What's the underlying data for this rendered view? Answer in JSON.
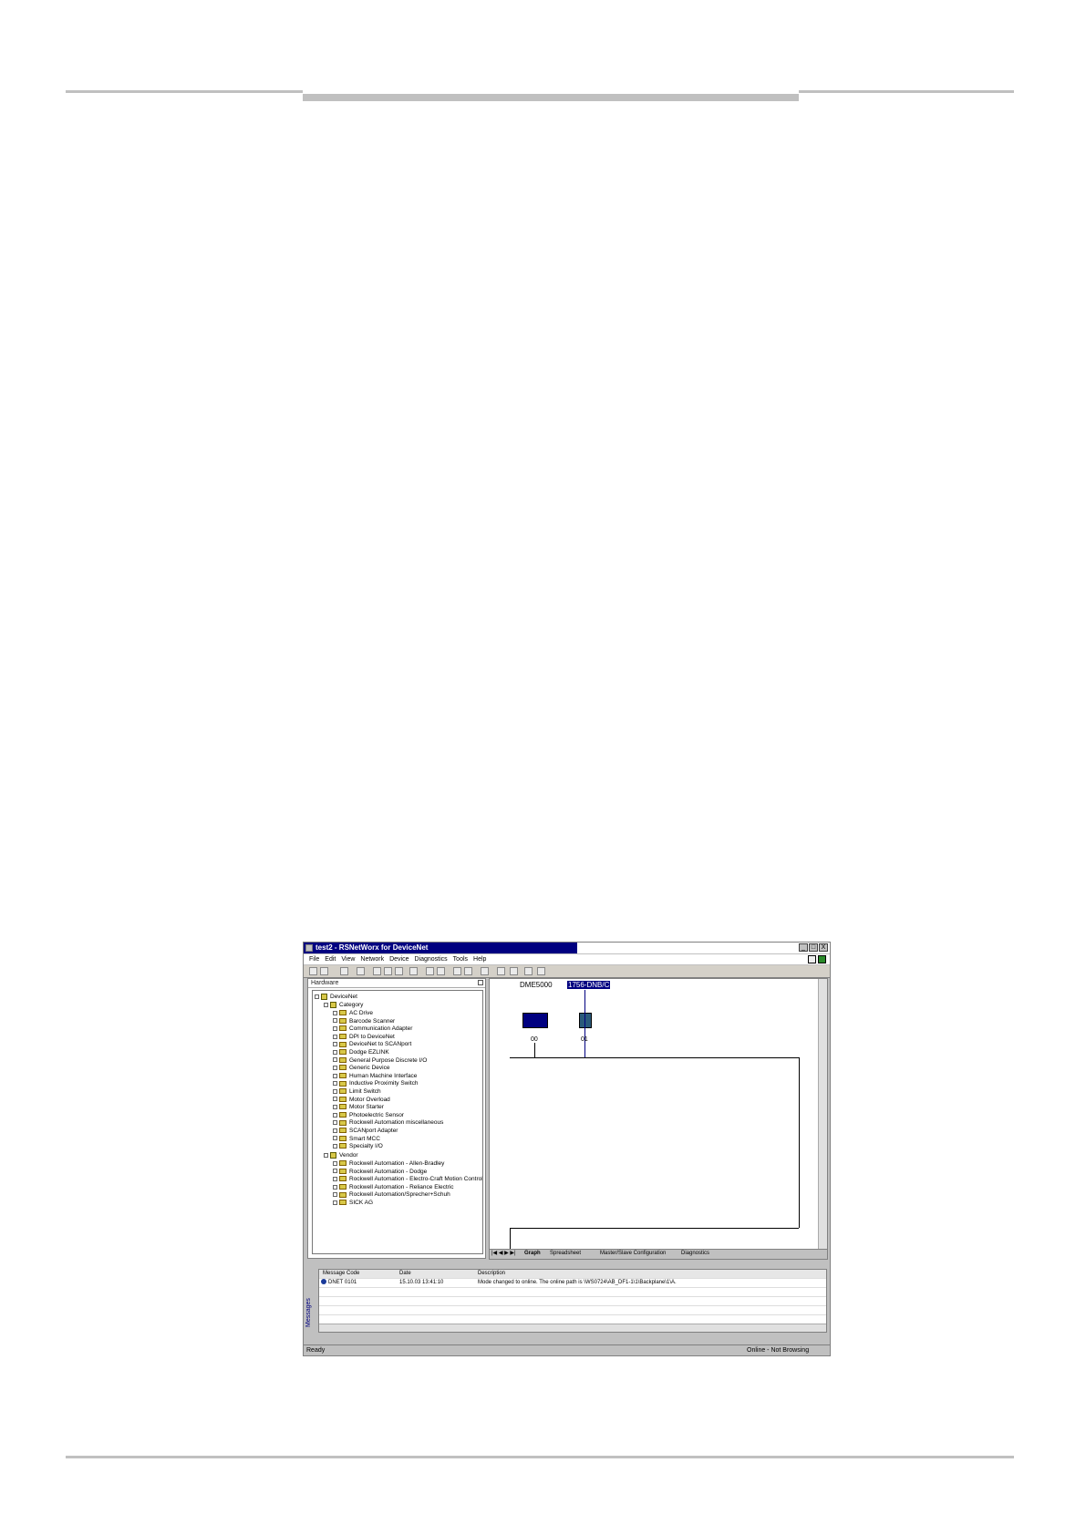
{
  "window": {
    "title": "test2 - RSNetWorx for DeviceNet",
    "controls": [
      "_",
      "□",
      "X"
    ]
  },
  "menu": [
    "File",
    "Edit",
    "View",
    "Network",
    "Device",
    "Diagnostics",
    "Tools",
    "Help"
  ],
  "hardware_pane": {
    "title": "Hardware",
    "root": "DeviceNet",
    "category_label": "Category",
    "categories": [
      "AC Drive",
      "Barcode Scanner",
      "Communication Adapter",
      "DPI to DeviceNet",
      "DeviceNet to SCANport",
      "Dodge EZLINK",
      "General Purpose Discrete I/O",
      "Generic Device",
      "Human Machine Interface",
      "Inductive Proximity Switch",
      "Limit Switch",
      "Motor Overload",
      "Motor Starter",
      "Photoelectric Sensor",
      "Rockwell Automation miscellaneous",
      "SCANport Adapter",
      "Smart MCC",
      "Specialty I/O"
    ],
    "vendor_label": "Vendor",
    "vendors": [
      "Rockwell Automation - Allen-Bradley",
      "Rockwell Automation - Dodge",
      "Rockwell Automation - Electro-Craft Motion Control",
      "Rockwell Automation - Reliance Electric",
      "Rockwell Automation/Sprecher+Schuh",
      "SICK AG"
    ]
  },
  "graph": {
    "device1_label": "DME5000",
    "device1_node": "00",
    "device2_label": "1756-DNB/C",
    "device2_node": "01",
    "tabs": [
      "Graph",
      "Spreadsheet",
      "Master/Slave Configuration",
      "Diagnostics"
    ]
  },
  "messages": {
    "side_label": "Messages",
    "columns": [
      "Message Code",
      "Date",
      "Description"
    ],
    "rows": [
      {
        "code": "DNET 0101",
        "date": "15.10.03 13:41:10",
        "description": "Mode changed to online.  The online path is \\WS0724\\AB_DF1-1\\1\\Backplane\\1\\A."
      }
    ]
  },
  "status": {
    "left": "Ready",
    "right": "Online - Not Browsing"
  }
}
